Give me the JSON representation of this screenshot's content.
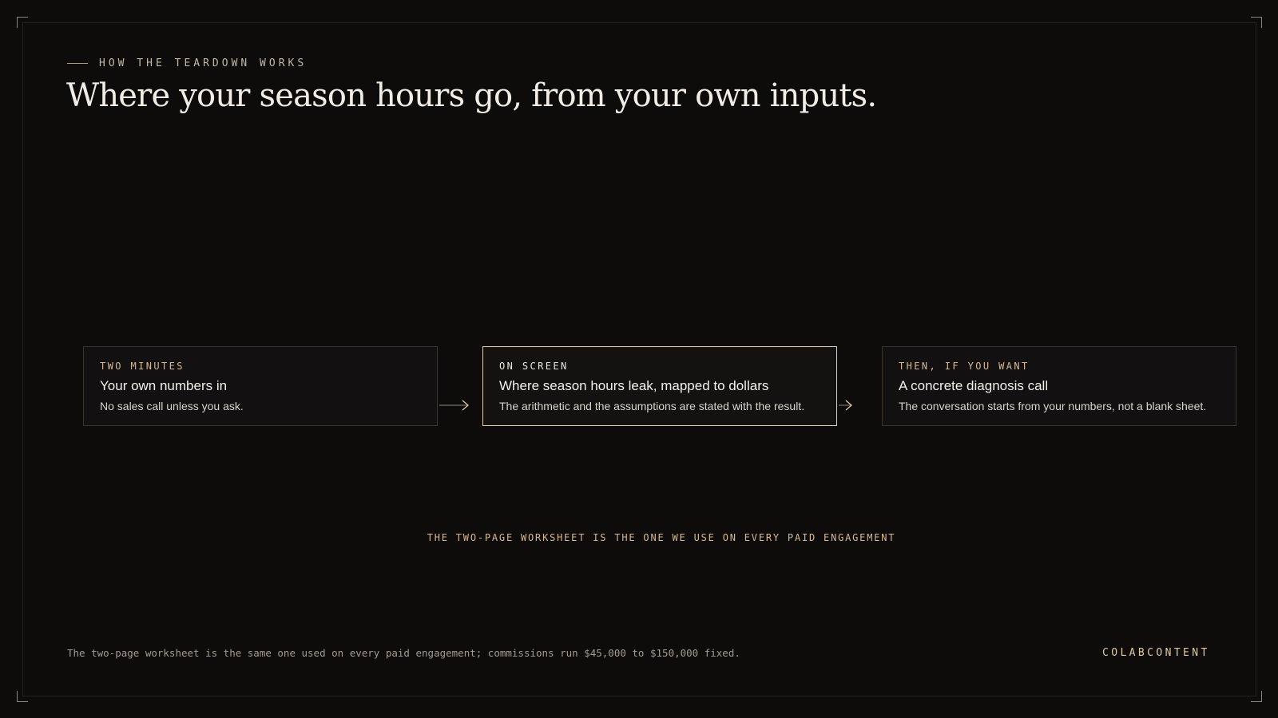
{
  "header": {
    "eyebrow": "HOW THE TEARDOWN WORKS",
    "title": "Where your season hours go, from your own inputs."
  },
  "steps": [
    {
      "kicker": "TWO MINUTES",
      "title": "Your own numbers in",
      "description": "No sales call unless you ask."
    },
    {
      "kicker": "ON SCREEN",
      "title": "Where season hours leak, mapped to dollars",
      "description": "The arithmetic and the assumptions are stated with the result."
    },
    {
      "kicker": "THEN, IF YOU WANT",
      "title": "A concrete diagnosis call",
      "description": "The conversation starts from your numbers, not a blank sheet."
    }
  ],
  "subnote": "THE TWO-PAGE WORKSHEET IS THE ONE WE USE ON EVERY PAID ENGAGEMENT",
  "footer": {
    "note": "The two-page worksheet is the same one used on every paid engagement; commissions run $45,000 to $150,000 fixed.",
    "brand": "COLABCONTENT"
  },
  "colors": {
    "background": "#0e0c0b",
    "accent": "#d6b98f",
    "active_border": "#e2cfae",
    "text": "#f1ece4"
  },
  "icons": {
    "step_connector": "arrow-right-icon"
  }
}
